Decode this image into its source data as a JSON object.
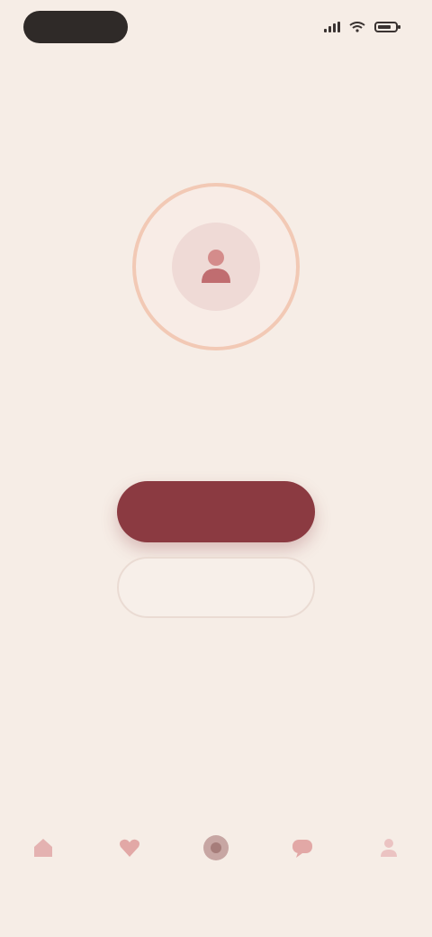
{
  "status_bar": {
    "time": "",
    "icons": [
      "signal-icon",
      "wifi-icon",
      "battery-icon"
    ]
  },
  "hero": {
    "icon": "user-icon",
    "ring_color": "#f2c9b5",
    "accent": "#8b3a41"
  },
  "title": "",
  "subtitle": "",
  "buttons": {
    "primary_label": "",
    "secondary_label": ""
  },
  "footer_link": "",
  "bottom_nav": {
    "items": [
      {
        "icon": "home-icon",
        "label": ""
      },
      {
        "icon": "heart-icon",
        "label": ""
      },
      {
        "icon": "record-icon",
        "label": ""
      },
      {
        "icon": "chat-icon",
        "label": ""
      },
      {
        "icon": "profile-icon",
        "label": ""
      }
    ]
  },
  "colors": {
    "background": "#f6ede6",
    "primary": "#8b3a41",
    "text": "#6c3c3f",
    "muted": "#a08782"
  }
}
